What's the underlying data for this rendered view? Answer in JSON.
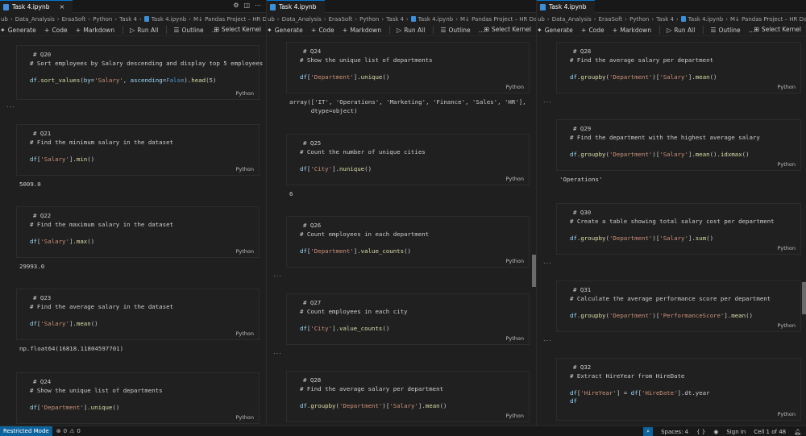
{
  "panes": [
    {
      "tab": "Task 4.ipynb",
      "breadcrumb": [
        "ub",
        "Data_Analysis",
        "EraaSoft",
        "Python",
        "Task 4",
        "Task 4.ipynb",
        "M↓ Pandas Project – HR Dataset"
      ],
      "cells": [
        {
          "q": "# Q20",
          "desc": "# Sort employees by Salary descending and display top 5 employees",
          "code": "df.sort_values(by='Salary', ascending=False).head(5)",
          "lang": "Python",
          "output": "",
          "dots": "..."
        },
        {
          "q": "# Q21",
          "desc": "# Find the minimum salary in the dataset",
          "code": "df['Salary'].min()",
          "lang": "Python",
          "output": "5009.0"
        },
        {
          "q": "# Q22",
          "desc": "# Find the maximum salary in the dataset",
          "code": "df['Salary'].max()",
          "lang": "Python",
          "output": "29993.0"
        },
        {
          "q": "# Q23",
          "desc": "# Find the average salary in the dataset",
          "code": "df['Salary'].mean()",
          "lang": "Python",
          "output": "np.float64(16818.11804597701)"
        },
        {
          "q": "# Q24",
          "desc": "# Show the unique list of departments",
          "code": "df['Department'].unique()",
          "lang": "Python",
          "output": ""
        }
      ]
    },
    {
      "tab": "Task 4.ipynb",
      "breadcrumb": [
        "ub",
        "Data_Analysis",
        "EraaSoft",
        "Python",
        "Task 4",
        "Task 4.ipynb",
        "M↓ Pandas Project – HR Dataset"
      ],
      "cells": [
        {
          "q": "# Q24",
          "desc": "# Show the unique list of departments",
          "code": "df['Department'].unique()",
          "lang": "Python",
          "output": "array(['IT', 'Operations', 'Marketing', 'Finance', 'Sales', 'HR'],\n      dtype=object)"
        },
        {
          "q": "# Q25",
          "desc": "# Count the number of unique cities",
          "code": "df['City'].nunique()",
          "lang": "Python",
          "output": "6"
        },
        {
          "q": "# Q26",
          "desc": "# Count employees in each department",
          "code": "df['Department'].value_counts()",
          "lang": "Python",
          "output": "",
          "dots": "..."
        },
        {
          "q": "# Q27",
          "desc": "# Count employees in each city",
          "code": "df['City'].value_counts()",
          "lang": "Python",
          "output": "",
          "dots": "..."
        },
        {
          "q": "# Q28",
          "desc": "# Find the average salary per department",
          "code": "df.groupby('Department')['Salary'].mean()",
          "lang": "Python",
          "output": ""
        }
      ]
    },
    {
      "tab": "Task 4.ipynb",
      "breadcrumb": [
        "ub",
        "Data_Analysis",
        "EraaSoft",
        "Python",
        "Task 4",
        "Task 4.ipynb",
        "M↓ Pandas Project – HR Dataset"
      ],
      "cells": [
        {
          "q": "# Q28",
          "desc": "# Find the average salary per department",
          "code": "df.groupby('Department')['Salary'].mean()",
          "lang": "Python",
          "output": "",
          "dots": "..."
        },
        {
          "q": "# Q29",
          "desc": "# Find the department with the highest average salary",
          "code": "df.groupby('Department')['Salary'].mean().idxmax()",
          "lang": "Python",
          "output": "'Operations'"
        },
        {
          "q": "# Q30",
          "desc": "# Create a table showing total salary cost per department",
          "code": "df.groupby('Department')['Salary'].sum()",
          "lang": "Python",
          "output": "",
          "dots": "..."
        },
        {
          "q": "# Q31",
          "desc": "# Calculate the average performance score per department",
          "code": "df.groupby('Department')['PerformanceScore'].mean()",
          "lang": "Python",
          "output": "",
          "dots": "..."
        },
        {
          "q": "# Q32",
          "desc": "# Extract HireYear from HireDate",
          "code": "df['HireYear'] = df['HireDate'].dt.year\ndf",
          "lang": "Python",
          "output": ""
        }
      ]
    }
  ],
  "toolbar": {
    "generate": "Generate",
    "code": "Code",
    "markdown": "Markdown",
    "run_all": "Run All",
    "outline": "Outline",
    "more": "…",
    "kernel": "Select Kernel"
  },
  "status": {
    "restricted": "Restricted Mode",
    "problems": "0",
    "warnings": "0",
    "spaces": "Spaces: 4",
    "braces": "{ }",
    "signin": "Sign in",
    "cell": "Cell 1 of 48"
  },
  "colors": {
    "accent": "#0078d4",
    "status_blue": "#0e639c",
    "background": "#1f1f1f"
  }
}
